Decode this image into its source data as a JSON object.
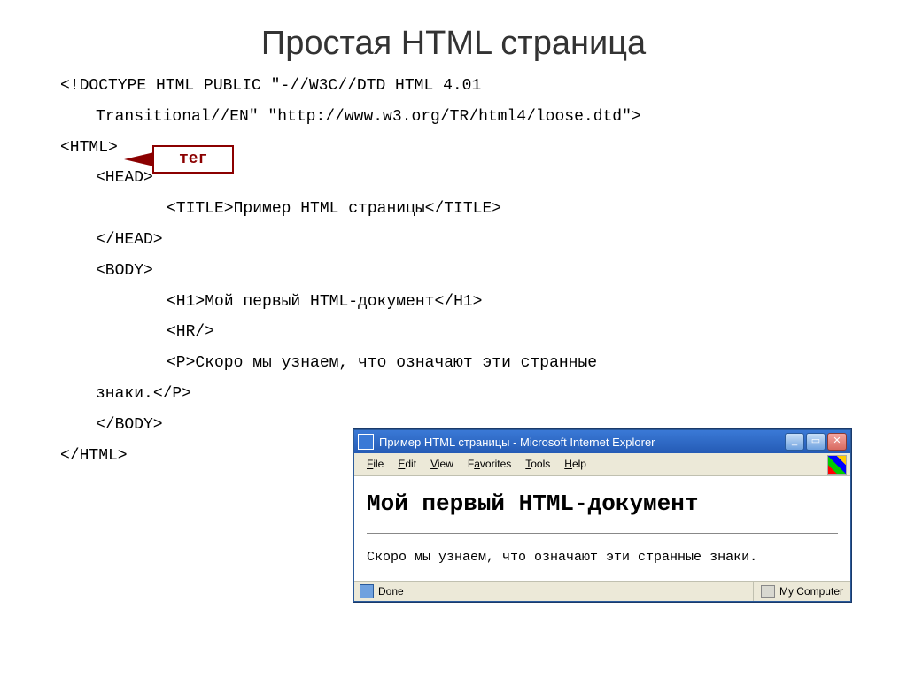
{
  "slide": {
    "title": "Простая HTML страница"
  },
  "code": {
    "l1a": "<!DOCTYPE HTML PUBLIC \"-//W3C//DTD HTML 4.01",
    "l1b": "Transitional//EN\" \"http://www.w3.org/TR/html4/loose.dtd\">",
    "l2": "<HTML>",
    "l3": "<HEAD>",
    "l4a": "<TITLE>",
    "l4b": "Пример HTML страницы",
    "l4c": "</TITLE>",
    "l5": "</HEAD>",
    "l6": "<BODY>",
    "l7a": "<H1>",
    "l7b": "Мой первый HTML-документ",
    "l7c": "</H1>",
    "l8": "<HR/>",
    "l9a": "<P>",
    "l9b": "Скоро мы узнаем, что означают эти странные",
    "l9c": "знаки.",
    "l9d": "</P>",
    "l10": "</BODY>",
    "l11": "</HTML>"
  },
  "callout": {
    "label": "тег"
  },
  "ie": {
    "title": "Пример HTML страницы - Microsoft Internet Explorer",
    "menu": {
      "file": "File",
      "edit": "Edit",
      "view": "View",
      "favorites": "Favorites",
      "tools": "Tools",
      "help": "Help"
    },
    "page": {
      "h1": "Мой первый HTML-документ",
      "p": "Скоро мы узнаем, что означают эти странные знаки."
    },
    "status": {
      "done": "Done",
      "zone": "My Computer"
    }
  }
}
